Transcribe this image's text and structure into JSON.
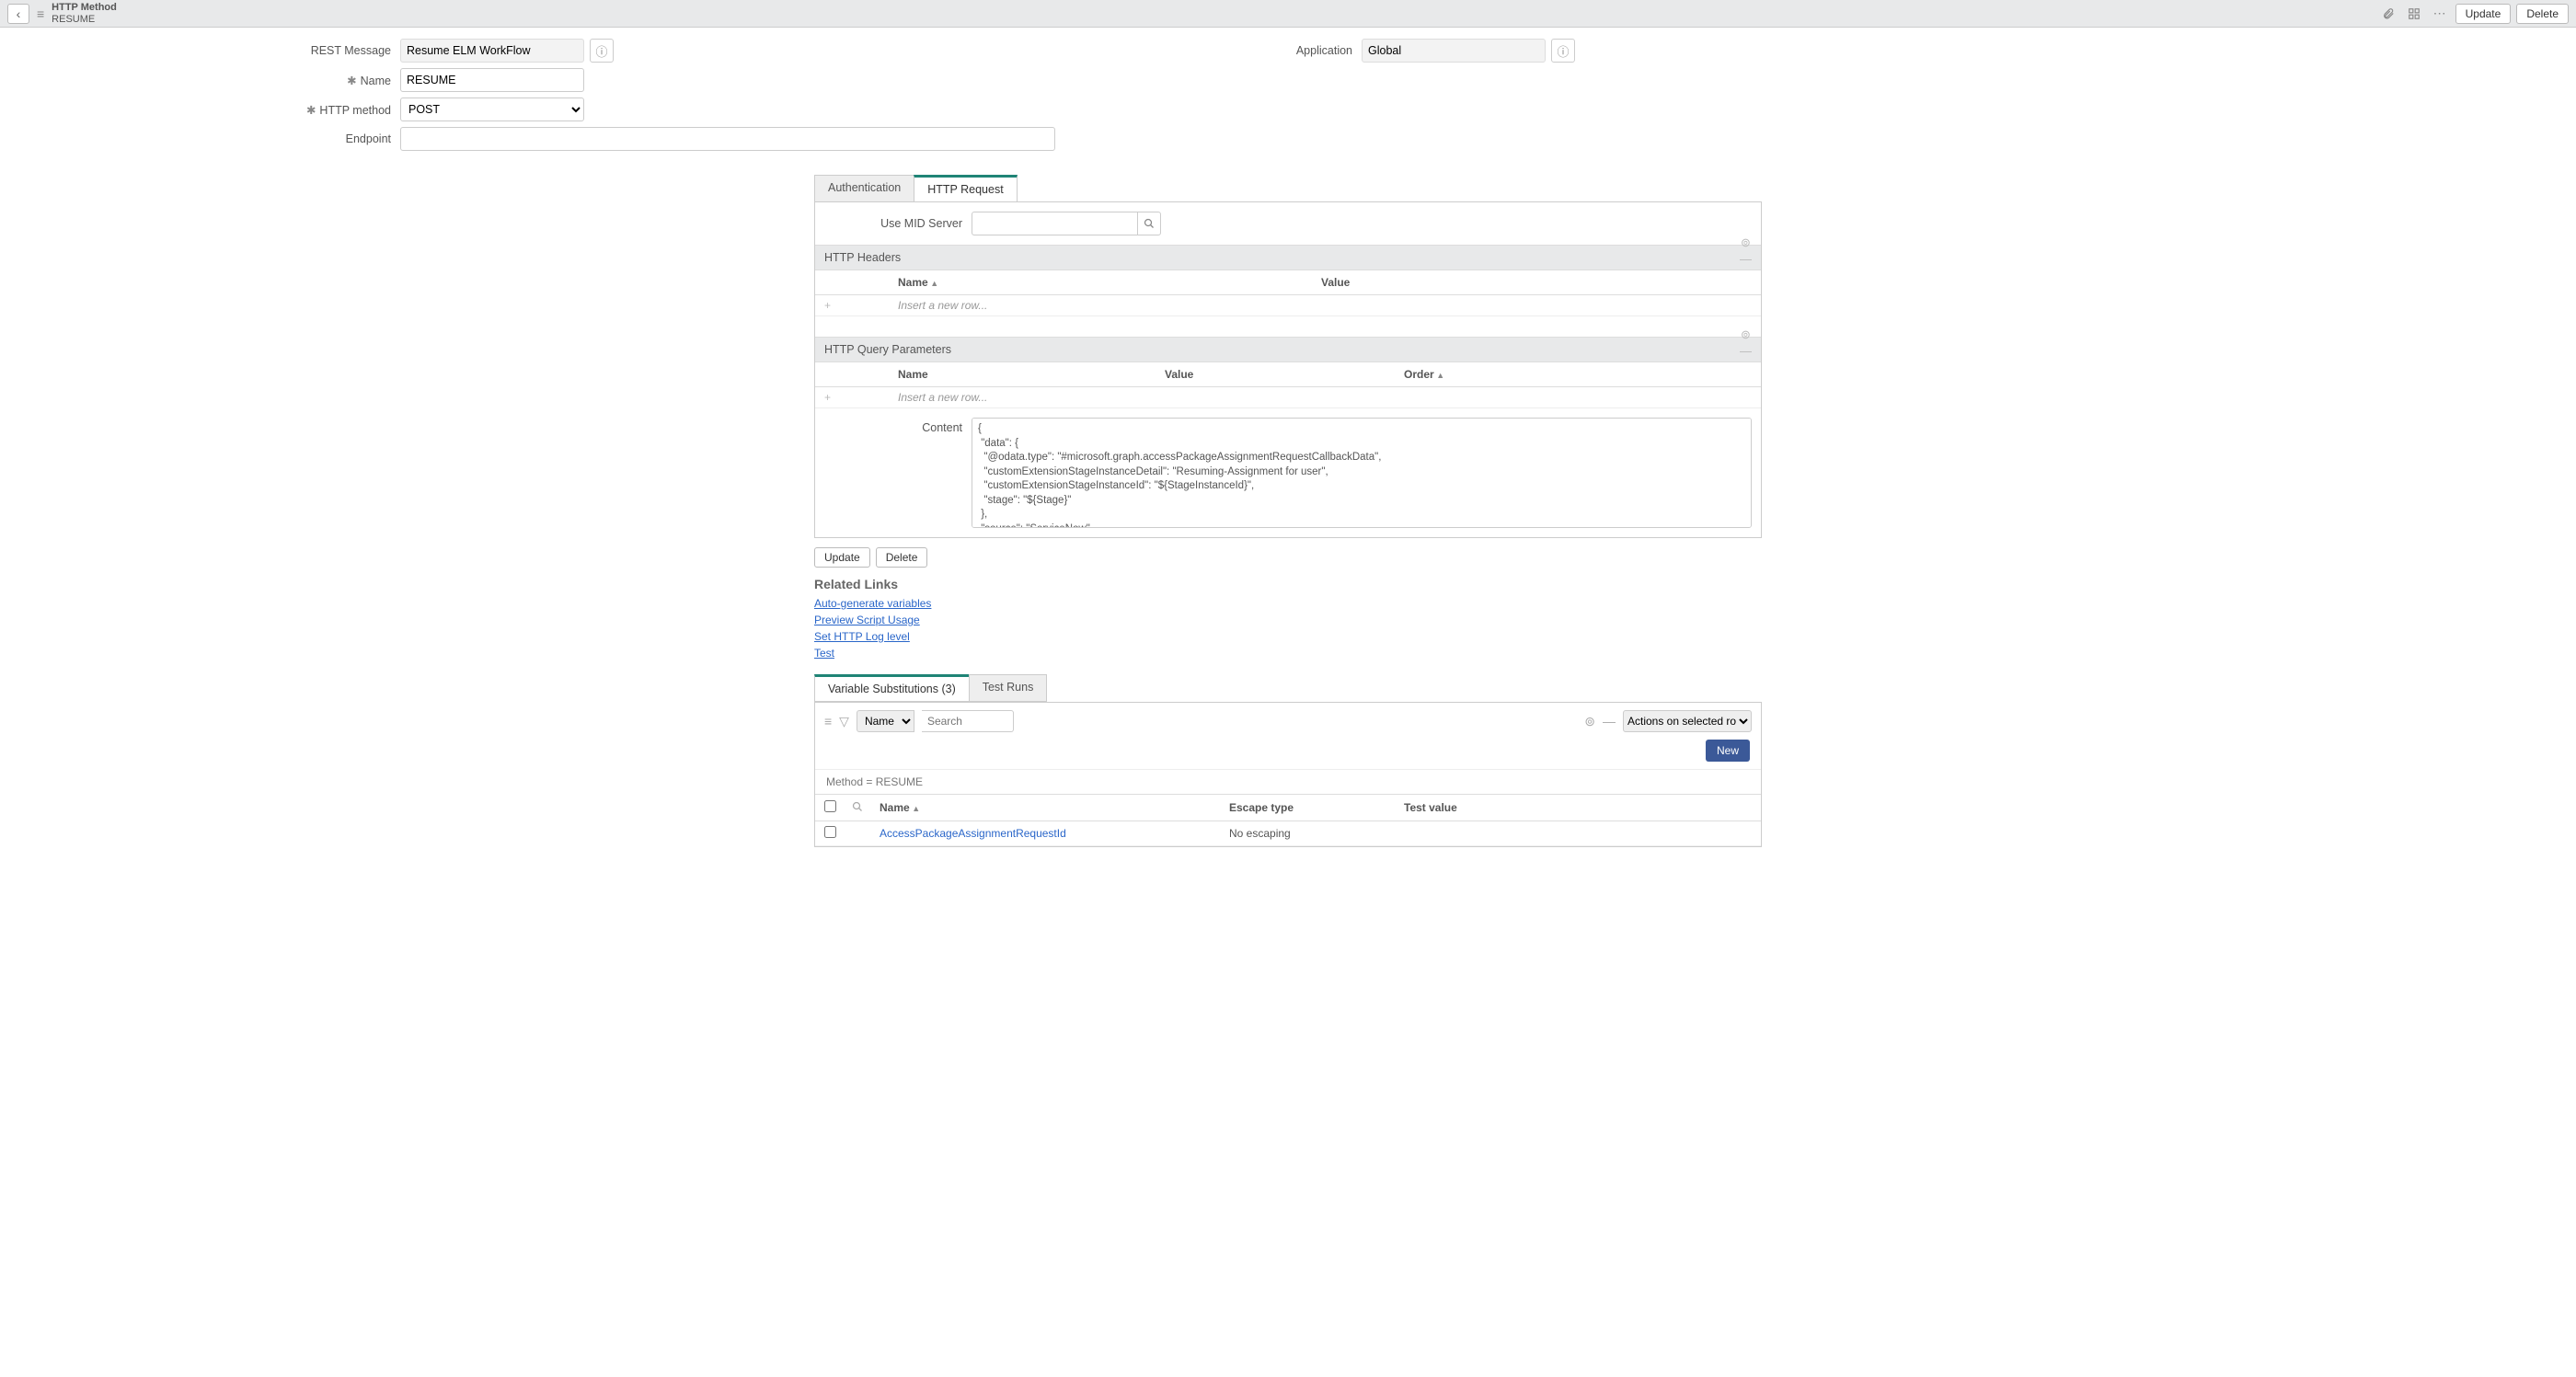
{
  "header": {
    "type": "HTTP Method",
    "name": "RESUME",
    "update": "Update",
    "delete": "Delete"
  },
  "form": {
    "rest_message_label": "REST Message",
    "rest_message_value": "Resume ELM WorkFlow",
    "application_label": "Application",
    "application_value": "Global",
    "name_label": "Name",
    "name_value": "RESUME",
    "http_method_label": "HTTP method",
    "http_method_value": "POST",
    "endpoint_label": "Endpoint",
    "endpoint_value": ""
  },
  "tabs": {
    "auth": "Authentication",
    "http_request": "HTTP Request"
  },
  "http_request": {
    "mid_label": "Use MID Server",
    "headers_title": "HTTP Headers",
    "headers_col_name": "Name",
    "headers_col_value": "Value",
    "insert_row": "Insert a new row...",
    "query_title": "HTTP Query Parameters",
    "query_col_name": "Name",
    "query_col_value": "Value",
    "query_col_order": "Order",
    "content_label": "Content",
    "content_value": "{\n \"data\": {\n  \"@odata.type\": \"#microsoft.graph.accessPackageAssignmentRequestCallbackData\",\n  \"customExtensionStageInstanceDetail\": \"Resuming-Assignment for user\",\n  \"customExtensionStageInstanceId\": \"${StageInstanceId}\",\n  \"stage\": \"${Stage}\"\n },\n \"source\": \"ServiceNow\",\n \"type\": \"microsoft.graph.accessPackageCustomExtensionStage.${Stage}\"\n}"
  },
  "buttons": {
    "update": "Update",
    "delete": "Delete"
  },
  "related": {
    "title": "Related Links",
    "links": [
      "Auto-generate variables",
      "Preview Script Usage",
      "Set HTTP Log level",
      "Test"
    ]
  },
  "list_tabs": {
    "varsub": "Variable Substitutions (3)",
    "testruns": "Test Runs"
  },
  "list": {
    "filter_field": "Name",
    "filter_placeholder": "Search",
    "actions_placeholder": "Actions on selected rows...",
    "new": "New",
    "breadcrumb": "Method = RESUME",
    "col_name": "Name",
    "col_escape": "Escape type",
    "col_test": "Test value",
    "row1_name": "AccessPackageAssignmentRequestId",
    "row1_escape": "No escaping",
    "row1_test": ""
  }
}
